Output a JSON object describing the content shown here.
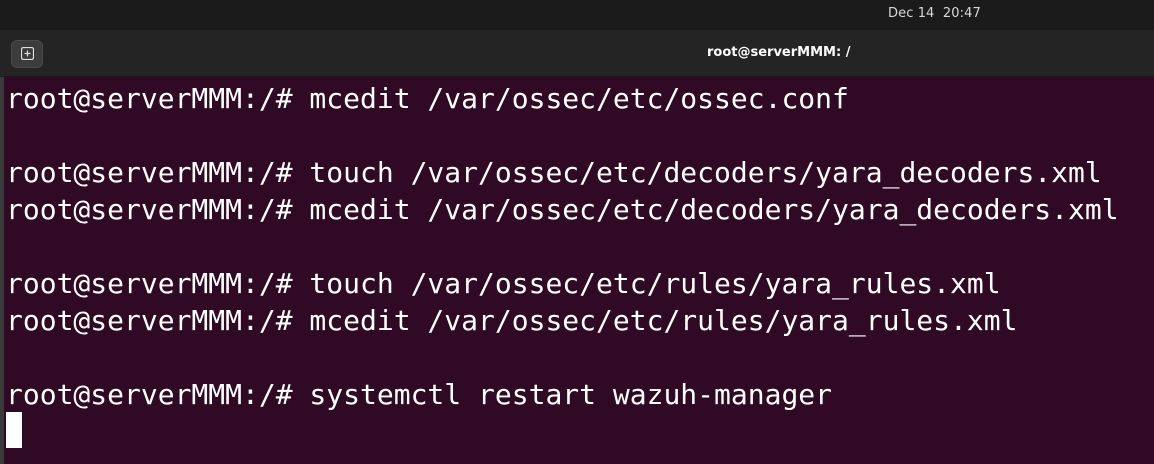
{
  "system_bar": {
    "clock": "Dec 14  20:47"
  },
  "window": {
    "title": "root@serverMMM: /",
    "new_tab_icon": "new-tab-icon"
  },
  "terminal": {
    "lines": [
      "root@serverMMM:/# mcedit /var/ossec/etc/ossec.conf",
      "",
      "root@serverMMM:/# touch /var/ossec/etc/decoders/yara_decoders.xml",
      "root@serverMMM:/# mcedit /var/ossec/etc/decoders/yara_decoders.xml",
      "",
      "root@serverMMM:/# touch /var/ossec/etc/rules/yara_rules.xml",
      "root@serverMMM:/# mcedit /var/ossec/etc/rules/yara_rules.xml",
      "",
      "root@serverMMM:/# systemctl restart wazuh-manager"
    ]
  },
  "colors": {
    "terminal_bg": "#300a24",
    "terminal_fg": "#ffffff",
    "titlebar_bg": "#242424",
    "topbar_bg": "#1b1b1b"
  }
}
